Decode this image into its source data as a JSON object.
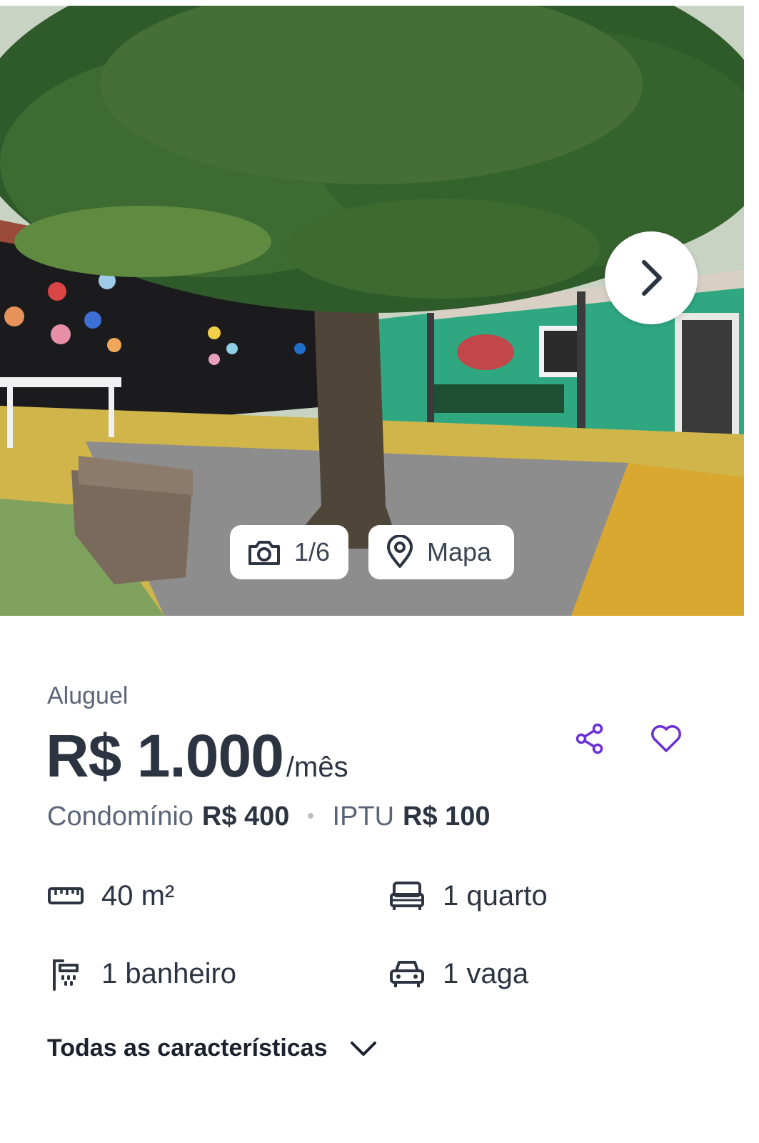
{
  "gallery": {
    "counter": "1/6",
    "map_label": "Mapa",
    "icons": {
      "next": "chevron-right-icon",
      "counter": "camera-icon",
      "map": "map-pin-icon"
    }
  },
  "listing": {
    "type_label": "Aluguel",
    "price": "R$ 1.000",
    "price_unit": "/mês",
    "fees": {
      "condo_label": "Condomínio",
      "condo_value": "R$ 400",
      "iptu_label": "IPTU",
      "iptu_value": "R$ 100"
    },
    "actions": {
      "share_icon": "share-icon",
      "favorite_icon": "heart-icon",
      "accent_color": "#6b2fd6"
    }
  },
  "features": {
    "area": "40 m²",
    "rooms": "1 quarto",
    "bathrooms": "1 banheiro",
    "parking": "1 vaga"
  },
  "all_features_label": "Todas as características",
  "colors": {
    "text_primary": "#2c3442",
    "text_secondary": "#5a6577",
    "accent": "#6b2fd6"
  }
}
